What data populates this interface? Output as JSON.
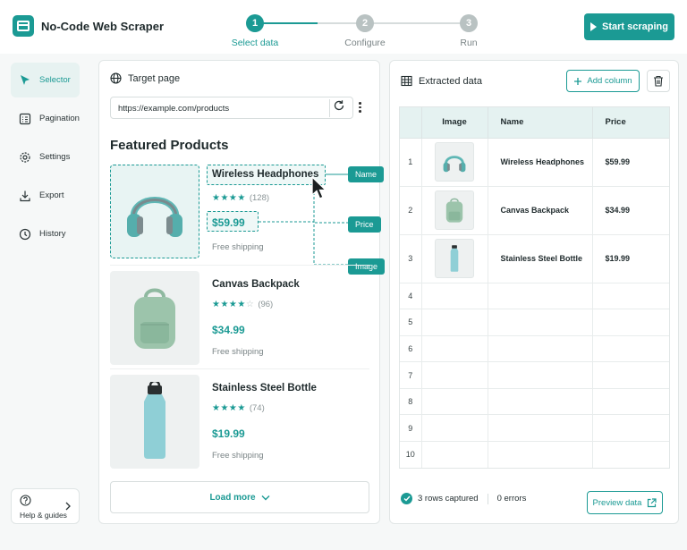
{
  "app": {
    "title": "No-Code Web Scraper"
  },
  "stepper": {
    "steps": [
      {
        "number": "1",
        "label": "Select data",
        "active": true
      },
      {
        "number": "2",
        "label": "Configure",
        "active": false
      },
      {
        "number": "3",
        "label": "Run",
        "active": false
      }
    ]
  },
  "header": {
    "start_label": "Start scraping"
  },
  "sidebar": {
    "items": [
      {
        "label": "Selector",
        "icon": "cursor-icon",
        "active": true
      },
      {
        "label": "Pagination",
        "icon": "pagination-icon"
      },
      {
        "label": "Settings",
        "icon": "gear-icon"
      },
      {
        "label": "Export",
        "icon": "download-icon"
      },
      {
        "label": "History",
        "icon": "clock-icon"
      }
    ],
    "help_label": "Help & guides"
  },
  "target": {
    "title": "Target page",
    "url": "https://example.com/products",
    "section_title": "Featured Products",
    "products": [
      {
        "name": "Wireless Headphones",
        "rating": 4.5,
        "stars": "★★★★",
        "stars_empty": "",
        "count": "(128)",
        "price": "$59.99",
        "shipping": "Free shipping"
      },
      {
        "name": "Canvas Backpack",
        "rating": 3.5,
        "stars": "★★★★",
        "stars_empty": "☆",
        "count": "(96)",
        "price": "$34.99",
        "shipping": "Free shipping"
      },
      {
        "name": "Stainless Steel Bottle",
        "rating": 4.5,
        "stars": "★★★★",
        "stars_empty": "",
        "count": "(74)",
        "price": "$19.99",
        "shipping": "Free shipping"
      }
    ],
    "tags": {
      "name": "Name",
      "price": "Price",
      "image": "Image"
    },
    "load_more": "Load more"
  },
  "extracted": {
    "title": "Extracted data",
    "add_column": "Add column",
    "columns": [
      "Image",
      "Name",
      "Price"
    ],
    "rows": [
      {
        "num": "1",
        "name": "Wireless Headphones",
        "price": "$59.99"
      },
      {
        "num": "2",
        "name": "Canvas Backpack",
        "price": "$34.99"
      },
      {
        "num": "3",
        "name": "Stainless Steel Bottle",
        "price": "$19.99"
      }
    ],
    "empty_rows": [
      "4",
      "5",
      "6",
      "7",
      "8",
      "9",
      "10"
    ],
    "status": {
      "rows": "3 rows captured",
      "errors": "0 errors"
    },
    "preview_label": "Preview data"
  },
  "colors": {
    "accent": "#1b9a94",
    "accent_light": "#e5f2f1"
  }
}
